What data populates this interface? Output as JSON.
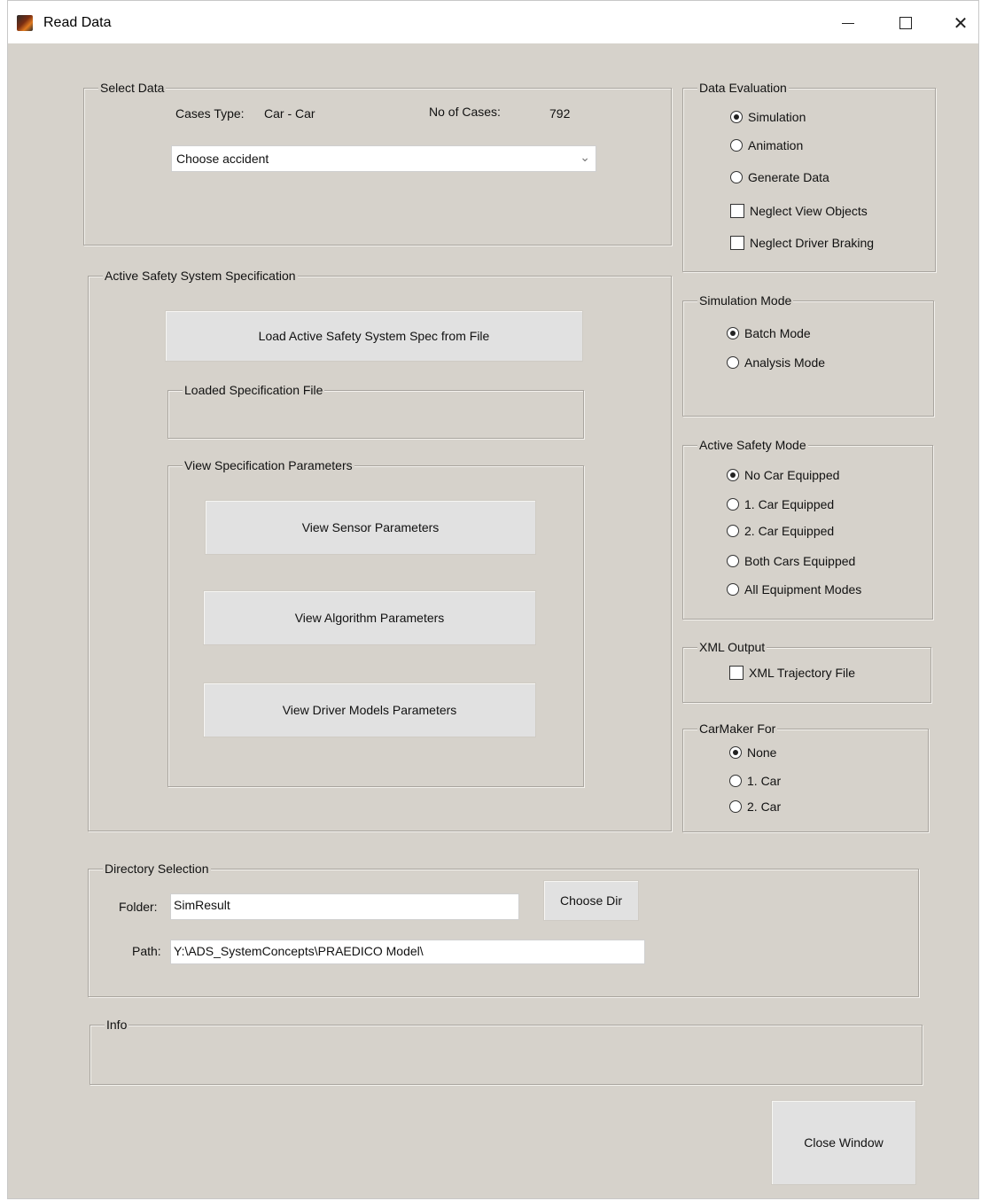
{
  "window": {
    "title": "Read Data"
  },
  "titlebar": {
    "minimize": "—",
    "maximize": "",
    "close": "✕"
  },
  "select_data": {
    "legend": "Select Data",
    "cases_type_label": "Cases Type:",
    "cases_type_value": "Car - Car",
    "no_cases_label": "No of Cases:",
    "no_cases_value": "792",
    "dropdown_value": "Choose accident"
  },
  "active_safety_spec": {
    "legend": "Active Safety System Specification",
    "load_button": "Load Active Safety System Spec from File",
    "loaded_file_legend": "Loaded Specification File",
    "loaded_file_value": "",
    "view_params_legend": "View Specification Parameters",
    "view_sensor_button": "View Sensor Parameters",
    "view_algorithm_button": "View Algorithm Parameters",
    "view_driver_button": "View Driver Models Parameters"
  },
  "data_evaluation": {
    "legend": "Data Evaluation",
    "options": [
      {
        "label": "Simulation",
        "selected": true
      },
      {
        "label": "Animation",
        "selected": false
      },
      {
        "label": "Generate Data",
        "selected": false
      }
    ],
    "checkboxes": [
      {
        "label": "Neglect View Objects",
        "checked": false
      },
      {
        "label": "Neglect Driver Braking",
        "checked": false
      }
    ]
  },
  "simulation_mode": {
    "legend": "Simulation Mode",
    "options": [
      {
        "label": "Batch Mode",
        "selected": true
      },
      {
        "label": "Analysis Mode",
        "selected": false
      }
    ]
  },
  "active_safety_mode": {
    "legend": "Active Safety Mode",
    "options": [
      {
        "label": "No Car Equipped",
        "selected": true
      },
      {
        "label": "1. Car Equipped",
        "selected": false
      },
      {
        "label": "2. Car Equipped",
        "selected": false
      },
      {
        "label": "Both Cars Equipped",
        "selected": false
      },
      {
        "label": "All Equipment Modes",
        "selected": false
      }
    ]
  },
  "xml_output": {
    "legend": "XML Output",
    "checkbox": {
      "label": "XML Trajectory File",
      "checked": false
    }
  },
  "carmaker": {
    "legend": "CarMaker For",
    "options": [
      {
        "label": "None",
        "selected": true
      },
      {
        "label": "1. Car",
        "selected": false
      },
      {
        "label": "2. Car",
        "selected": false
      }
    ]
  },
  "directory": {
    "legend": "Directory Selection",
    "folder_label": "Folder:",
    "folder_value": "SimResult",
    "choose_dir_button": "Choose Dir",
    "path_label": "Path:",
    "path_value": "Y:\\ADS_SystemConcepts\\PRAEDICO Model\\"
  },
  "info": {
    "legend": "Info",
    "text": ""
  },
  "close_button": "Close Window",
  "colors": {
    "background": "#d6d2cb",
    "button": "#e1e1e1",
    "titlebar": "#ffffff"
  }
}
